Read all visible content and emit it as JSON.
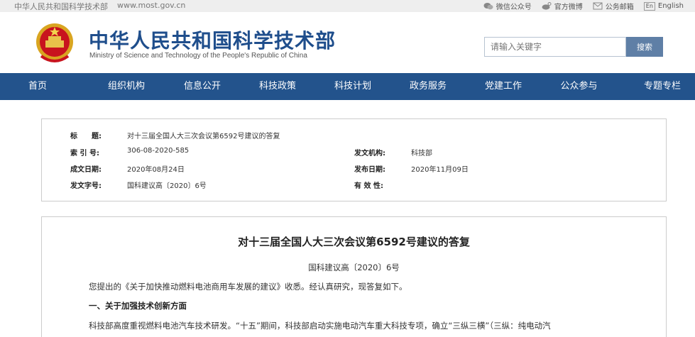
{
  "topbar": {
    "site_name": "中华人民共和国科学技术部",
    "site_url": "www.most.gov.cn",
    "links": [
      {
        "label": "微信公众号",
        "icon": "wechat-icon"
      },
      {
        "label": "官方微博",
        "icon": "weibo-icon"
      },
      {
        "label": "公务邮箱",
        "icon": "mail-icon"
      },
      {
        "label": "English",
        "icon": "en-icon",
        "icon_text": "En"
      }
    ]
  },
  "header": {
    "title_cn": "中华人民共和国科学技术部",
    "title_en": "Ministry of Science and Technology of the People's Republic of China",
    "search_placeholder": "请输入关键字",
    "search_button": "搜索"
  },
  "nav": {
    "items": [
      {
        "label": "首页"
      },
      {
        "label": "组织机构"
      },
      {
        "label": "信息公开"
      },
      {
        "label": "科技政策"
      },
      {
        "label": "科技计划"
      },
      {
        "label": "政务服务"
      },
      {
        "label": "党建工作"
      },
      {
        "label": "公众参与"
      },
      {
        "label": "专题专栏"
      }
    ]
  },
  "meta": {
    "title_label": "标　　题:",
    "title_value": "对十三届全国人大三次会议第6592号建议的答复",
    "index_label": "索 引 号:",
    "index_value": "306-08-2020-585",
    "issuer_label": "发文机构:",
    "issuer_value": "科技部",
    "created_label": "成文日期:",
    "created_value": "2020年08月24日",
    "published_label": "发布日期:",
    "published_value": "2020年11月09日",
    "docno_label": "发文字号:",
    "docno_value": "国科建议高〔2020〕6号",
    "validity_label": "有 效 性:",
    "validity_value": ""
  },
  "article": {
    "title": "对十三届全国人大三次会议第6592号建议的答复",
    "doc_number": "国科建议高〔2020〕6号",
    "para1": "您提出的《关于加快推动燃料电池商用车发展的建议》收悉。经认真研究，现答复如下。",
    "heading1": "一、关于加强技术创新方面",
    "para2": "科技部高度重视燃料电池汽车技术研发。“十五”期间，科技部启动实施电动汽车重大科技专项，确立“三纵三横”（三纵：纯电动汽"
  }
}
